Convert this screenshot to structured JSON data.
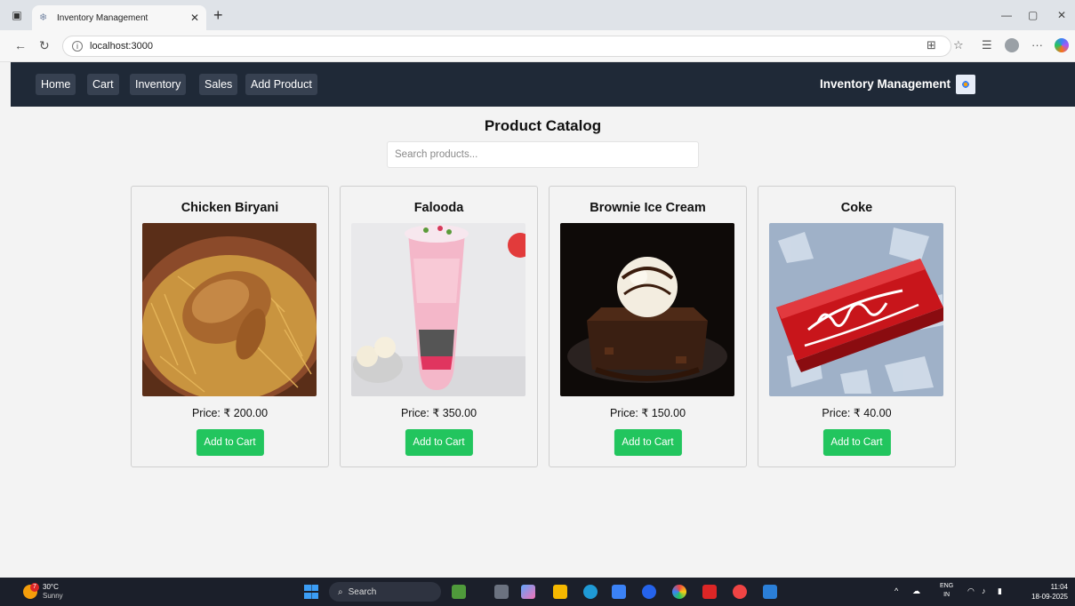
{
  "browser": {
    "tab_title": "Inventory Management",
    "url": "localhost:3000"
  },
  "nav": {
    "links": [
      "Home",
      "Cart",
      "Inventory",
      "Sales",
      "Add Product"
    ],
    "brand": "Inventory Management"
  },
  "main": {
    "heading": "Product Catalog",
    "search_placeholder": "Search products..."
  },
  "products": [
    {
      "name": "Chicken Biryani",
      "price": "Price: ₹ 200.00",
      "button": "Add to Cart",
      "image": "chicken-biryani-photo"
    },
    {
      "name": "Falooda",
      "price": "Price: ₹ 350.00",
      "button": "Add to Cart",
      "image": "falooda-photo"
    },
    {
      "name": "Brownie Ice Cream",
      "price": "Price: ₹ 150.00",
      "button": "Add to Cart",
      "image": "brownie-ice-cream-photo"
    },
    {
      "name": "Coke",
      "price": "Price: ₹ 40.00",
      "button": "Add to Cart",
      "image": "coca-cola-can-photo"
    }
  ],
  "taskbar": {
    "temperature": "30°C",
    "weather": "Sunny",
    "weather_badge": "7",
    "search_label": "Search",
    "lang_top": "ENG",
    "lang_bottom": "IN",
    "time": "11:04",
    "date": "18-09-2025"
  },
  "colors": {
    "navbar": "#1f2937",
    "nav_button": "#374151",
    "add_button": "#22c55e",
    "page_bg": "#f3f3f3"
  }
}
